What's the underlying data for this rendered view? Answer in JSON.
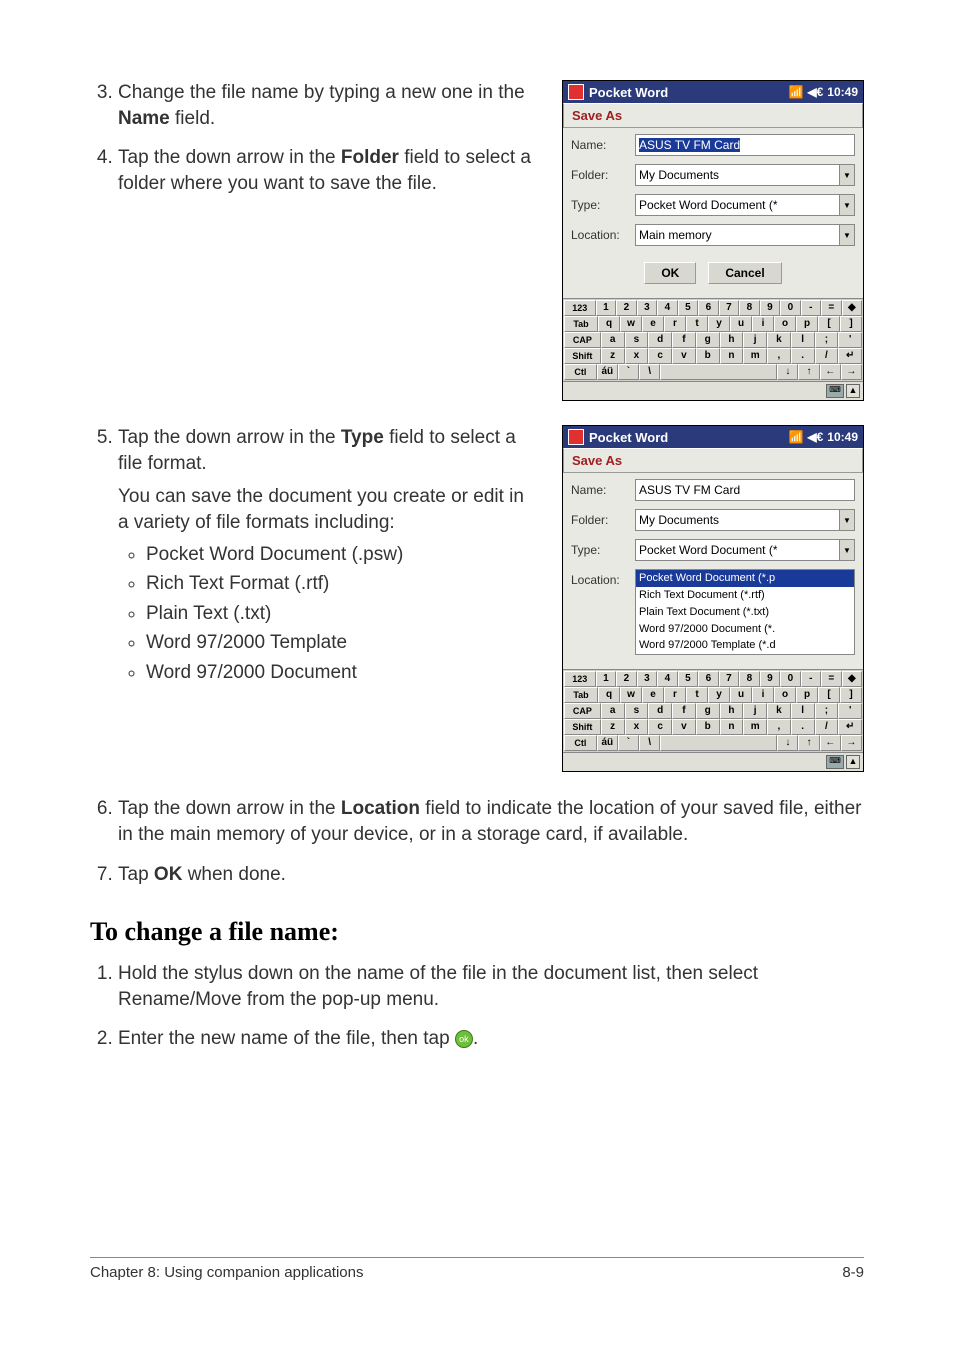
{
  "steps_a": {
    "s3_a": "Change the file name by typing a new one in the ",
    "s3_b": "Name",
    "s3_c": " field.",
    "s4_a": "Tap the down arrow in the ",
    "s4_b": "Folder",
    "s4_c": " field to select a folder where you want to save the file."
  },
  "steps_b": {
    "s5_a": "Tap the down arrow in the ",
    "s5_b": "Type",
    "s5_c": " field to select a file format.",
    "s5_para": "You can save the document you create or edit in a variety of file formats including:",
    "bullets": [
      "Pocket Word Document (.psw)",
      "Rich Text Format (.rtf)",
      "Plain Text (.txt)",
      "Word 97/2000 Template",
      "Word 97/2000 Document"
    ],
    "s6_a": "Tap the down arrow in the ",
    "s6_b": "Location",
    "s6_c": " field to indicate the location of your saved file, either in the main memory of your device, or in a storage card, if available.",
    "s7_a": "Tap ",
    "s7_b": "OK",
    "s7_c": " when done."
  },
  "section2": {
    "heading": "To change a file name:",
    "s1": "Hold the stylus down on the name of the file in the document list, then select Rename/Move from the pop-up menu.",
    "s2_a": "Enter the new name of the file, then tap ",
    "s2_ok": "ok",
    "s2_b": "."
  },
  "footer": {
    "left": "Chapter 8: Using companion applications",
    "right": "8-9"
  },
  "device1": {
    "title": "Pocket Word",
    "time": "10:49",
    "tab": "Save As",
    "labels": {
      "name": "Name:",
      "folder": "Folder:",
      "type": "Type:",
      "location": "Location:"
    },
    "name_value": "ASUS TV FM Card",
    "folder_value": "My Documents",
    "type_value": "Pocket Word Document (*",
    "location_value": "Main memory",
    "ok": "OK",
    "cancel": "Cancel"
  },
  "device2": {
    "title": "Pocket Word",
    "time": "10:49",
    "tab": "Save As",
    "labels": {
      "name": "Name:",
      "folder": "Folder:",
      "type": "Type:",
      "location": "Location:"
    },
    "name_value": "ASUS TV FM Card",
    "folder_value": "My Documents",
    "type_value": "Pocket Word Document (*",
    "dd_items": [
      "Pocket Word Document (*.p",
      "Rich Text Document (*.rtf)",
      "Plain Text Document (*.txt)",
      "Word 97/2000 Document (*.",
      "Word 97/2000 Template (*.d"
    ]
  },
  "keyboard": {
    "r1": [
      "123",
      "1",
      "2",
      "3",
      "4",
      "5",
      "6",
      "7",
      "8",
      "9",
      "0",
      "-",
      "=",
      "◆"
    ],
    "r2": [
      "Tab",
      "q",
      "w",
      "e",
      "r",
      "t",
      "y",
      "u",
      "i",
      "o",
      "p",
      "[",
      "]"
    ],
    "r3": [
      "CAP",
      "a",
      "s",
      "d",
      "f",
      "g",
      "h",
      "j",
      "k",
      "l",
      ";",
      "'"
    ],
    "r4": [
      "Shift",
      "z",
      "x",
      "c",
      "v",
      "b",
      "n",
      "m",
      ",",
      ".",
      "/",
      "↵"
    ],
    "r5": [
      "Ctl",
      "áü",
      "`",
      "\\",
      " ",
      "↓",
      "↑",
      "←",
      "→"
    ]
  }
}
